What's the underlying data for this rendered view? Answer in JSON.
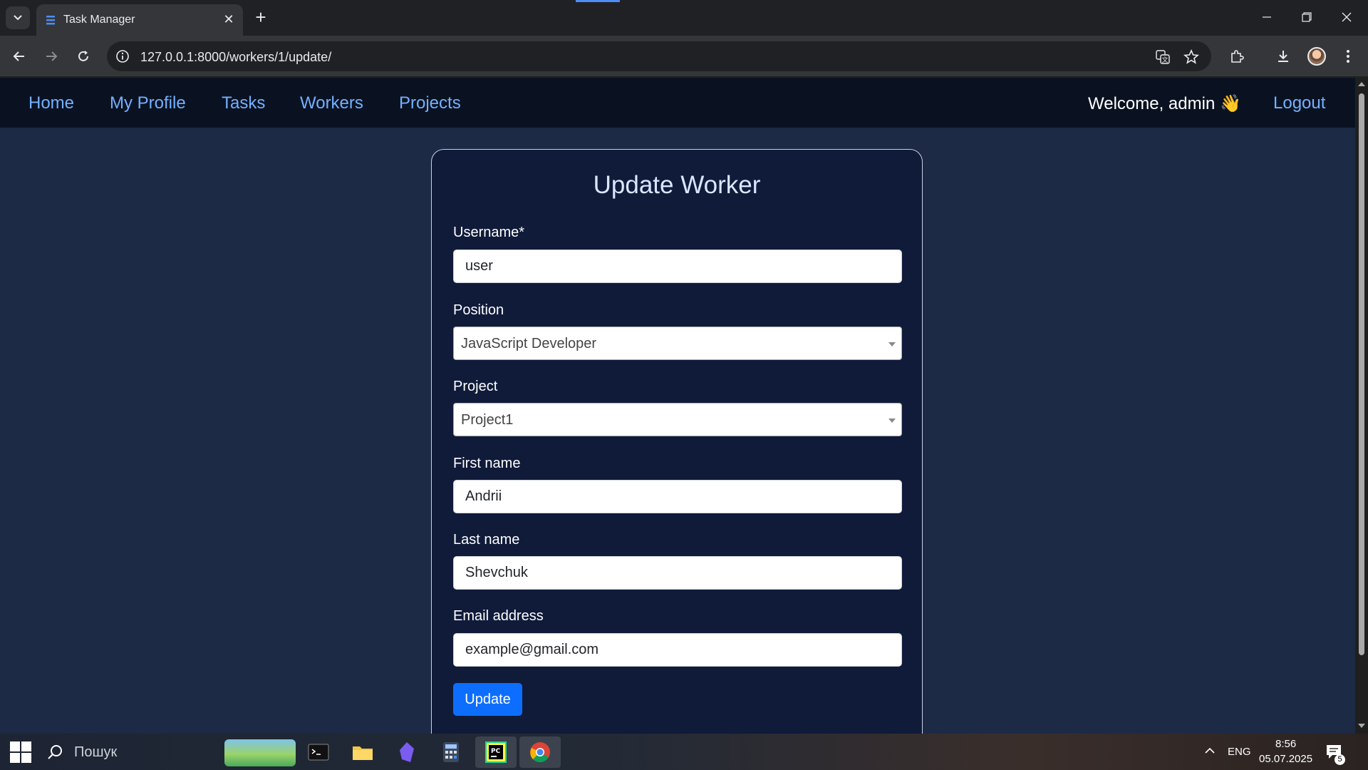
{
  "browser": {
    "tab_title": "Task Manager",
    "url": "127.0.0.1:8000/workers/1/update/"
  },
  "nav": {
    "home": "Home",
    "profile": "My Profile",
    "tasks": "Tasks",
    "workers": "Workers",
    "projects": "Projects",
    "welcome": "Welcome, admin 👋",
    "logout": "Logout"
  },
  "form": {
    "title": "Update Worker",
    "username_label": "Username*",
    "username_value": "user",
    "position_label": "Position",
    "position_value": "JavaScript Developer",
    "project_label": "Project",
    "project_value": "Project1",
    "first_name_label": "First name",
    "first_name_value": "Andrii",
    "last_name_label": "Last name",
    "last_name_value": "Shevchuk",
    "email_label": "Email address",
    "email_value": "example@gmail.com",
    "submit_label": "Update"
  },
  "taskbar": {
    "search_placeholder": "Пошук",
    "language": "ENG",
    "time": "8:56",
    "date": "05.07.2025",
    "notification_count": "5"
  },
  "colors": {
    "navbar_bg": "#0a1222",
    "page_bg": "#1d2a46",
    "card_bg": "#101b3a",
    "link": "#74b1ff",
    "primary_button": "#0d6efd"
  }
}
